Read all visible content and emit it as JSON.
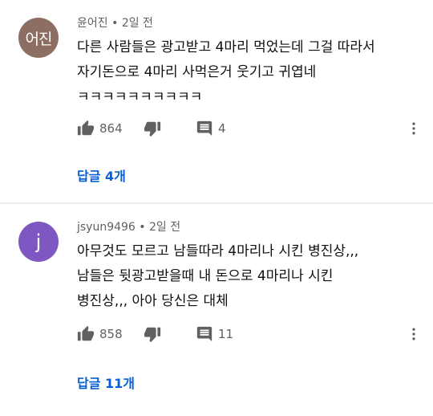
{
  "comments": [
    {
      "avatar_text": "어진",
      "avatar_color": "#8d6e63",
      "author": "윤어진",
      "time": "2일 전",
      "lines": [
        "다른 사람들은 광고받고 4마리 먹었는데 그걸 따라서",
        "자기돈으로 4마리 사먹은거 웃기고 귀엽네",
        "ㅋㅋㅋㅋㅋㅋㅋㅋㅋㅋ"
      ],
      "likes": "864",
      "replies_count": "4",
      "replies_link": "답글 4개"
    },
    {
      "avatar_text": "j",
      "avatar_color": "#7e57c2",
      "author": "jsyun9496",
      "time": "2일 전",
      "lines": [
        "아무것도 모르고 남들따라 4마리나 시킨 병진상,,,",
        "남들은 뒷광고받을때 내 돈으로 4마리나 시킨",
        "병진상,,, 아아 당신은 대체"
      ],
      "likes": "858",
      "replies_count": "11",
      "replies_link": "답글 11개"
    }
  ],
  "meta_separator": "•",
  "icons": {
    "like": "thumb-up-icon",
    "dislike": "thumb-down-icon",
    "reply": "comment-icon",
    "more": "more-vertical-icon"
  },
  "colors": {
    "link": "#065fd4",
    "secondary_text": "#606060",
    "icon": "#606060"
  }
}
